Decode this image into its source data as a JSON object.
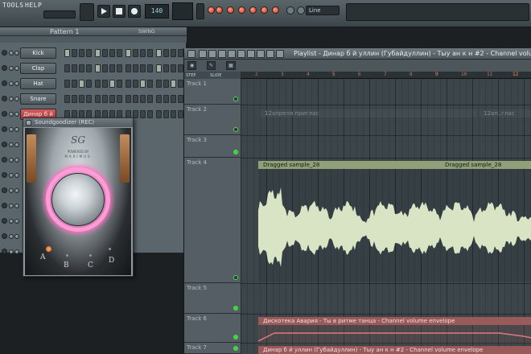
{
  "menu": [
    "TOOLS",
    "HELP"
  ],
  "transport": {
    "tempo": "140"
  },
  "snap": {
    "value": "Line"
  },
  "channel_rack": {
    "pattern": "Pattern 1",
    "swing_label": "SWING",
    "channels": [
      {
        "name": "Kick",
        "active": false,
        "steps": [
          1,
          0,
          0,
          0,
          1,
          0,
          0,
          0,
          1,
          0,
          0,
          0,
          1,
          0,
          0,
          0
        ]
      },
      {
        "name": "Clap",
        "active": false,
        "steps": [
          0,
          0,
          0,
          0,
          1,
          0,
          0,
          0,
          0,
          0,
          0,
          0,
          1,
          0,
          0,
          0
        ]
      },
      {
        "name": "Hat",
        "active": false,
        "steps": [
          0,
          0,
          1,
          0,
          0,
          0,
          1,
          0,
          0,
          0,
          1,
          0,
          0,
          0,
          1,
          0
        ]
      },
      {
        "name": "Snare",
        "active": false,
        "steps": [
          0,
          0,
          0,
          0,
          0,
          0,
          0,
          0,
          0,
          0,
          0,
          0,
          0,
          0,
          0,
          0
        ]
      },
      {
        "name": "Динар б й",
        "active": true,
        "steps": [
          0,
          0,
          0,
          0,
          0,
          0,
          0,
          0,
          0,
          0,
          0,
          0,
          0,
          0,
          0,
          0
        ]
      }
    ]
  },
  "plugin": {
    "title": "Soundgoodizer (REC)",
    "logo": "SG",
    "powered_by": "POWERED BY",
    "maximus": "MAXIMUS",
    "presets": [
      "A",
      "B",
      "C",
      "D"
    ],
    "selected_preset": "A"
  },
  "playlist": {
    "title": "Playlist - Динар б й уллин (Губайдуллин) - Тыу ан к н #2 - Channel volume",
    "step_label": "STEP",
    "slide_label": "SLIDE",
    "ruler": [
      "2",
      "3",
      "4",
      "5",
      "6",
      "7",
      "8",
      "9",
      "10",
      "11",
      "12"
    ],
    "tracks": [
      {
        "name": "Track 1",
        "led_on": false
      },
      {
        "name": "Track 2",
        "led_on": false
      },
      {
        "name": "Track 3",
        "led_on": true
      },
      {
        "name": "Track 4",
        "led_on": false
      },
      {
        "name": "Track 5",
        "led_on": true
      },
      {
        "name": "Track 6",
        "led_on": true
      },
      {
        "name": "Track 7",
        "led_on": true
      }
    ],
    "clips": {
      "ghost_1": "12апреля приглас",
      "ghost_2": "12ап..глас",
      "audio_1": "Dragged sample_28",
      "audio_2": "Dragged sample_28",
      "env_1": "Дискотека Авария - Ты в ритме танца - Channel volume envelope",
      "env_2": "Динар б й уллин (Губайдуллин) - Тыу ан к н #2 - Channel volume envelope"
    }
  },
  "colors": {
    "accent": "#ff8c5e",
    "audio_clip": "#92a07a",
    "envelope_clip": "#9b5a5a",
    "glow": "#ff6fc3"
  }
}
